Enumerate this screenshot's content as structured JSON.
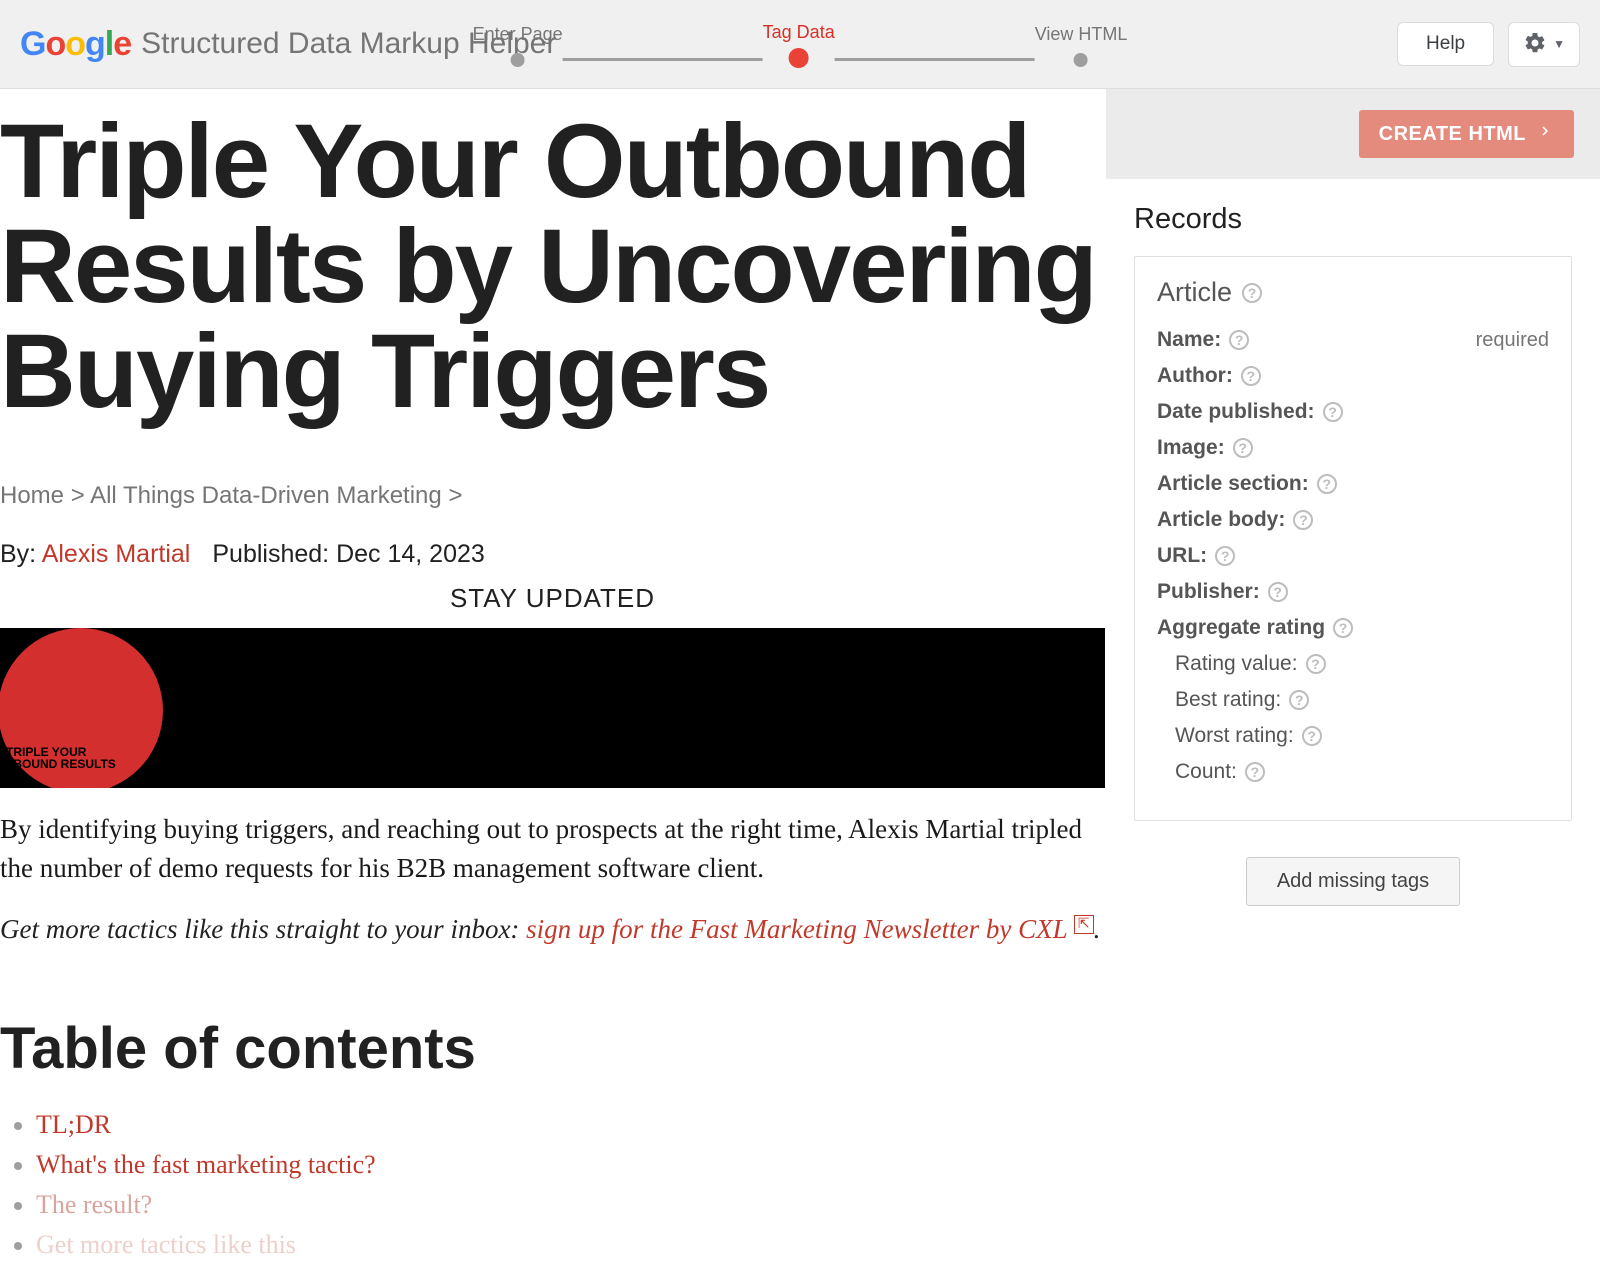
{
  "header": {
    "app_title": "Structured Data Markup Helper",
    "steps": [
      {
        "label": "Enter Page",
        "active": false
      },
      {
        "label": "Tag Data",
        "active": true
      },
      {
        "label": "View HTML",
        "active": false
      }
    ],
    "help_label": "Help"
  },
  "article": {
    "title": "Triple Your Outbound Results by Uncovering Buying Triggers",
    "breadcrumbs": {
      "home": "Home",
      "category": "All Things Data-Driven Marketing"
    },
    "byline_prefix": "By:",
    "author": "Alexis Martial",
    "published_prefix": "Published:",
    "published_date": "Dec 14, 2023",
    "stay_updated": "STAY UPDATED",
    "hero_overlay_line1": "TRIPLE YOUR",
    "hero_overlay_line2": "TBOUND RESULTS",
    "lede": "By identifying buying triggers, and reaching out to prospects at the right time, Alexis Martial tripled the number of demo requests for his B2B management software client.",
    "cta_prefix": "Get more tactics like this straight to your inbox: ",
    "cta_link": "sign up for the Fast Marketing Newsletter by CXL",
    "cta_badge": "⇱",
    "toc_title": "Table of contents",
    "toc": [
      "TL;DR",
      "What's the fast marketing tactic?",
      "The result?",
      "Get more tactics like this"
    ]
  },
  "side": {
    "create_html": "CREATE HTML",
    "records_title": "Records",
    "card_title": "Article",
    "required_label": "required",
    "fields": {
      "name": "Name:",
      "author": "Author:",
      "date_published": "Date published:",
      "image": "Image:",
      "article_section": "Article section:",
      "article_body": "Article body:",
      "url": "URL:",
      "publisher": "Publisher:",
      "aggregate_rating": "Aggregate rating",
      "rating_value": "Rating value:",
      "best_rating": "Best rating:",
      "worst_rating": "Worst rating:",
      "count": "Count:"
    },
    "add_missing": "Add missing tags"
  }
}
